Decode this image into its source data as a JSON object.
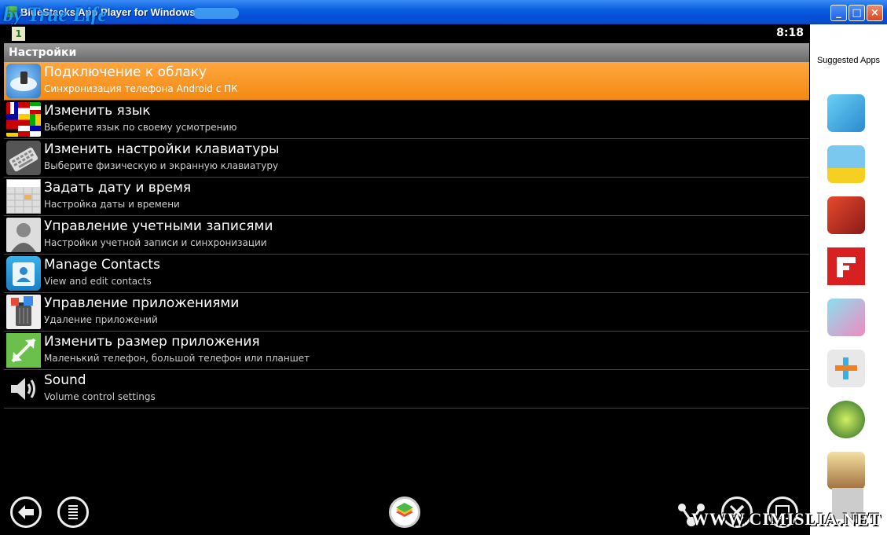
{
  "window": {
    "title": "BlueStacks App Player for Windows",
    "watermark": "by True Life"
  },
  "statusbar": {
    "notification": "1",
    "time": "8:18"
  },
  "header": {
    "title": "Настройки"
  },
  "settings": [
    {
      "title": "Подключение к облаку",
      "subtitle": "Синхронизация телефона Android с ПК",
      "icon": "cloud-sync-icon",
      "selected": true
    },
    {
      "title": "Изменить язык",
      "subtitle": "Выберите язык по своему усмотрению",
      "icon": "flags-icon"
    },
    {
      "title": "Изменить настройки клавиатуры",
      "subtitle": "Выберите физическую и экранную клавиатуру",
      "icon": "keyboard-icon"
    },
    {
      "title": "Задать дату и время",
      "subtitle": "Настройка даты и времени",
      "icon": "calendar-icon"
    },
    {
      "title": "Управление учетными записями",
      "subtitle": "Настройки учетной записи и синхронизации",
      "icon": "user-icon"
    },
    {
      "title": "Manage Contacts",
      "subtitle": "View and edit contacts",
      "icon": "contacts-icon"
    },
    {
      "title": "Управление приложениями",
      "subtitle": "Удаление приложений",
      "icon": "trash-apps-icon"
    },
    {
      "title": "Изменить размер приложения",
      "subtitle": "Маленький телефон, большой телефон или планшет",
      "icon": "resize-icon"
    },
    {
      "title": "Sound",
      "subtitle": "Volume control settings",
      "icon": "speaker-icon"
    }
  ],
  "sidebar": {
    "label": "Suggested Apps"
  },
  "footer_watermark": "WWW.CIMISLIA.NET",
  "colors": {
    "selected": "#f39a1e",
    "header": "#808080",
    "titlebar": "#0a5fe0"
  }
}
